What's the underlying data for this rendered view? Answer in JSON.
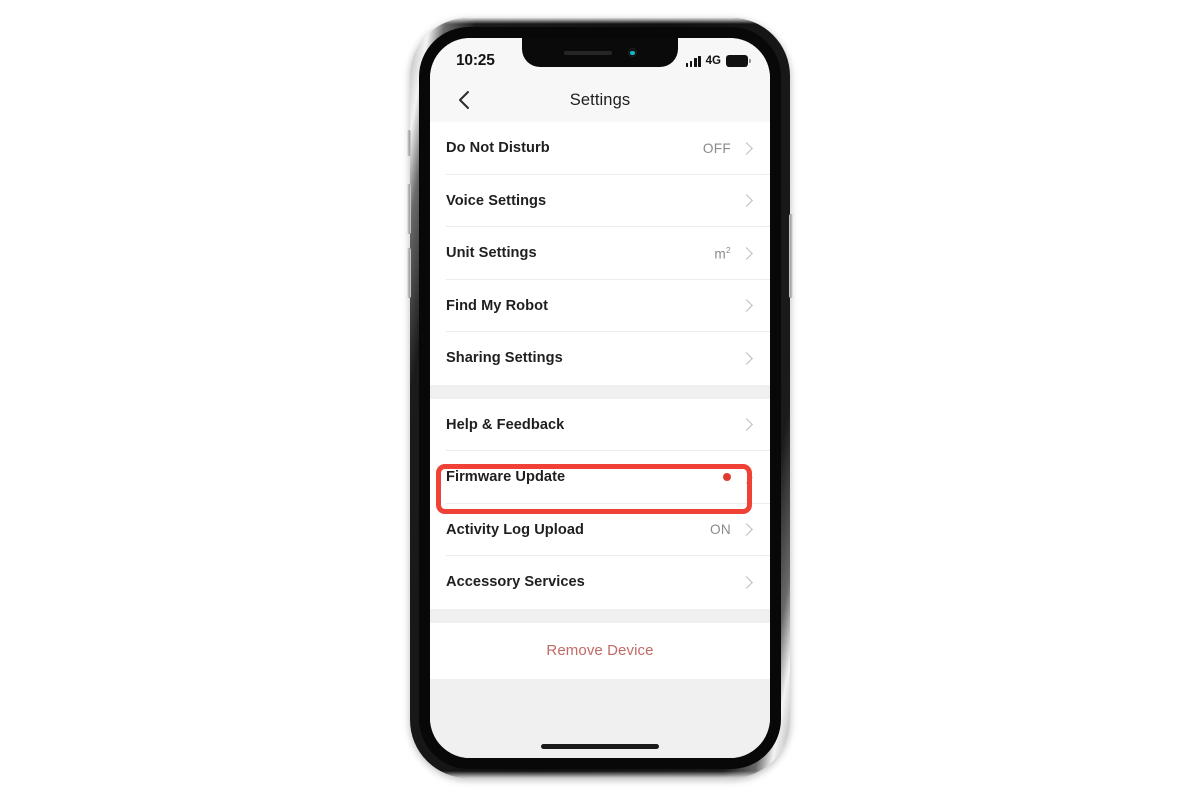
{
  "device": {
    "frame_color": "#101010",
    "screen_background": "#f2f2f2",
    "hardware": {
      "mute_switch": "mute-switch",
      "volume_up": "volume-up-button",
      "volume_down": "volume-down-button",
      "power": "power-button"
    },
    "notch": {
      "speaker": "earpiece-speaker",
      "camera": "front-camera",
      "camera_accent": "#12b6c8"
    },
    "home_indicator": "home-indicator"
  },
  "status_bar": {
    "time": "10:25",
    "signal_icon": "cellular-signal-icon",
    "signal_bars": 4,
    "network_type": "4G",
    "battery_icon": "battery-icon",
    "battery_level": 85
  },
  "nav_bar": {
    "back_icon": "chevron-left-icon",
    "title": "Settings"
  },
  "list": {
    "groups": [
      {
        "name": "group-primary",
        "rows": [
          {
            "label": "Do Not Disturb",
            "value": "OFF",
            "badge": false,
            "chevron": true
          },
          {
            "label": "Voice Settings",
            "value": "",
            "badge": false,
            "chevron": true
          },
          {
            "label": "Unit Settings",
            "value": "m2",
            "value_kind": "unit-area",
            "badge": false,
            "chevron": true
          },
          {
            "label": "Find My Robot",
            "value": "",
            "badge": false,
            "chevron": true
          },
          {
            "label": "Sharing Settings",
            "value": "",
            "badge": false,
            "chevron": true
          }
        ]
      },
      {
        "name": "group-support",
        "rows": [
          {
            "label": "Help & Feedback",
            "value": "",
            "badge": false,
            "chevron": true
          },
          {
            "label": "Firmware Update",
            "value": "",
            "badge": true,
            "chevron": true,
            "highlighted": true
          },
          {
            "label": "Activity Log Upload",
            "value": "ON",
            "badge": false,
            "chevron": true
          },
          {
            "label": "Accessory Services",
            "value": "",
            "badge": false,
            "chevron": true
          }
        ]
      }
    ]
  },
  "destructive_action": {
    "label": "Remove Device",
    "color": "#c16a66"
  },
  "annotation": {
    "highlight_target": "Firmware Update",
    "box_color": "#ef4136",
    "badge_color": "#e03b30"
  }
}
